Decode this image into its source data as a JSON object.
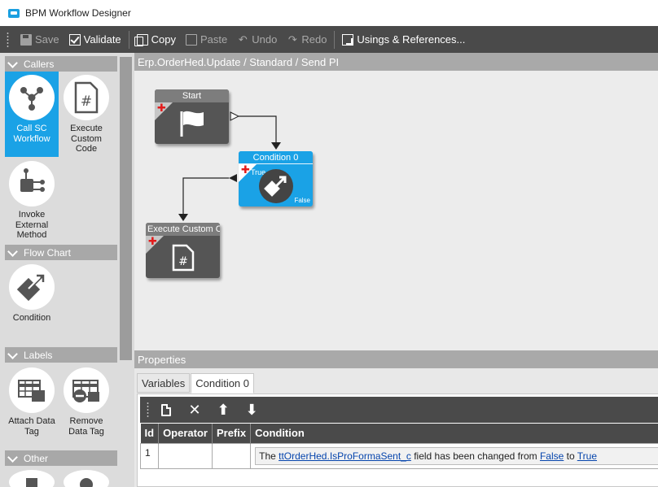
{
  "window": {
    "title": "BPM Workflow Designer"
  },
  "toolbar": {
    "save": "Save",
    "validate": "Validate",
    "copy": "Copy",
    "paste": "Paste",
    "undo": "Undo",
    "redo": "Redo",
    "usings": "Usings & References..."
  },
  "palette": {
    "categories": {
      "callers": "Callers",
      "flowchart": "Flow Chart",
      "labels": "Labels",
      "other": "Other"
    },
    "tools": {
      "call_sc": "Call SC Workflow",
      "execute": "Execute Custom Code",
      "invoke": "Invoke External Method",
      "condition": "Condition",
      "attach": "Attach Data Tag",
      "remove": "Remove Data Tag"
    }
  },
  "canvas": {
    "breadcrumb": "Erp.OrderHed.Update / Standard / Send PI",
    "nodes": {
      "start": "Start",
      "condition": "Condition 0",
      "condition_true": "True",
      "condition_false": "False",
      "execute": "Execute Custom Code"
    }
  },
  "properties": {
    "title": "Properties",
    "tabs": [
      "Variables",
      "Condition 0"
    ],
    "columns": [
      "Id",
      "Operator",
      "Prefix",
      "Condition"
    ],
    "row": {
      "id": "1",
      "operator": "",
      "prefix": "",
      "cond_pre": "The ",
      "cond_field": "ttOrderHed.IsProFormaSent_c",
      "cond_mid": " field has been changed from ",
      "cond_from": "False",
      "cond_to_word": " to ",
      "cond_to": "True"
    }
  },
  "colors": {
    "accent": "#1aa2e6",
    "toolbar": "#4a4a4a",
    "add": "#e21b1b"
  }
}
